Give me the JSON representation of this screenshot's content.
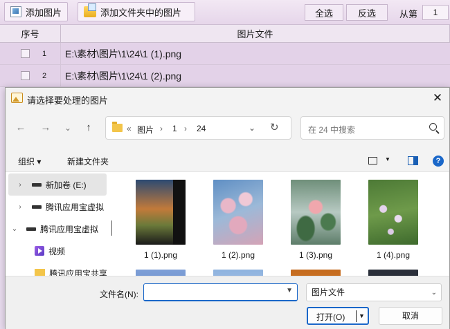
{
  "toolbar": {
    "add_image_label": "添加图片",
    "add_folder_label": "添加文件夹中的图片",
    "select_all_label": "全选",
    "invert_label": "反选",
    "from_label": "从第",
    "from_value": "1"
  },
  "table": {
    "headers": [
      "序号",
      "图片文件"
    ],
    "rows": [
      {
        "index": "1",
        "path": "E:\\素材\\图片\\1\\24\\1 (1).png"
      },
      {
        "index": "2",
        "path": "E:\\素材\\图片\\1\\24\\1 (2).png"
      }
    ]
  },
  "dialog": {
    "title": "请选择要处理的图片",
    "close_glyph": "✕",
    "nav": {
      "back": "←",
      "forward": "→",
      "recent": "⌄",
      "up": "↑"
    },
    "address": {
      "overflow": "«",
      "crumbs": [
        "图片",
        "1",
        "24"
      ],
      "separator": "›",
      "dropdown": "⌄",
      "refresh": "↻"
    },
    "search_placeholder": "在 24 中搜索",
    "commands": {
      "organize": "组织 ▾",
      "new_folder": "新建文件夹",
      "help": "?"
    },
    "nav_pane": [
      {
        "label": "新加卷 (E:)",
        "chevron": "›",
        "icon": "drive-icon",
        "selected": true
      },
      {
        "label": "腾讯应用宝虚拟",
        "chevron": "›",
        "icon": "drive-icon",
        "selected": false
      },
      {
        "label": "腾讯应用宝虚拟",
        "chevron": "⌄",
        "icon": "drive-icon",
        "selected": false
      },
      {
        "label": "视频",
        "chevron": "",
        "icon": "video-icon",
        "selected": false
      },
      {
        "label": "腾讯应用宝共享",
        "chevron": "",
        "icon": "folder-icon",
        "selected": false
      }
    ],
    "files": [
      {
        "name": "1 (1).png"
      },
      {
        "name": "1 (2).png"
      },
      {
        "name": "1 (3).png"
      },
      {
        "name": "1 (4).png"
      },
      {
        "name": ""
      },
      {
        "name": ""
      },
      {
        "name": ""
      },
      {
        "name": ""
      }
    ],
    "filename_label": "文件名(N):",
    "filename_value": "",
    "filter_value": "图片文件",
    "open_label": "打开(O)",
    "cancel_label": "取消"
  },
  "colors": {
    "accent": "#1a67c9",
    "app_background": "#e3d2e8"
  }
}
